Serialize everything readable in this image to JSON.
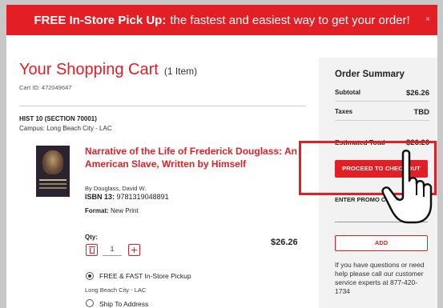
{
  "banner": {
    "bold": "FREE In-Store Pick Up:",
    "text": "the fastest and easiest way to get your order!",
    "close": "×"
  },
  "cart": {
    "title": "Your Shopping Cart",
    "count": "(1 Item)",
    "cart_id": "Cart ID: 472049647",
    "course": "HIST 10 (SECTION 70001)",
    "campus": "Campus:  Long Beach City - LAC"
  },
  "item": {
    "title": "Narrative of the Life of Frederick Douglass: An American Slave, Written by Himself",
    "author": "By Douglass, David W.",
    "isbn_label": "ISBN 13:",
    "isbn": "9781319048891",
    "format_label": "Format:",
    "format": "New Print",
    "qty_label": "Qty:",
    "qty": "1",
    "qty_add": "+",
    "price": "$26.26"
  },
  "delivery": {
    "option1": "FREE & FAST In-Store Pickup",
    "option1_sub": "Long Beach City - LAC",
    "option2": "Ship To Address",
    "selected": "option1"
  },
  "summary": {
    "title": "Order Summary",
    "subtotal_label": "Subtotal",
    "subtotal": "$26.26",
    "taxes_label": "Taxes",
    "taxes": "TBD",
    "total_label": "Estimated Total",
    "total": "$26.26",
    "checkout": "PROCEED TO CHECKOUT",
    "promo_label": "ENTER PROMO CODE",
    "add": "ADD",
    "help": "If you have questions or need help please call our customer service experts at 877-420-1734"
  },
  "colors": {
    "accent": "#e41e25",
    "panel": "#f2f2f2",
    "backdrop": "#c8c8c8"
  },
  "icons": [
    "close-icon",
    "trash-icon",
    "plus-icon",
    "pointing-hand-icon"
  ]
}
